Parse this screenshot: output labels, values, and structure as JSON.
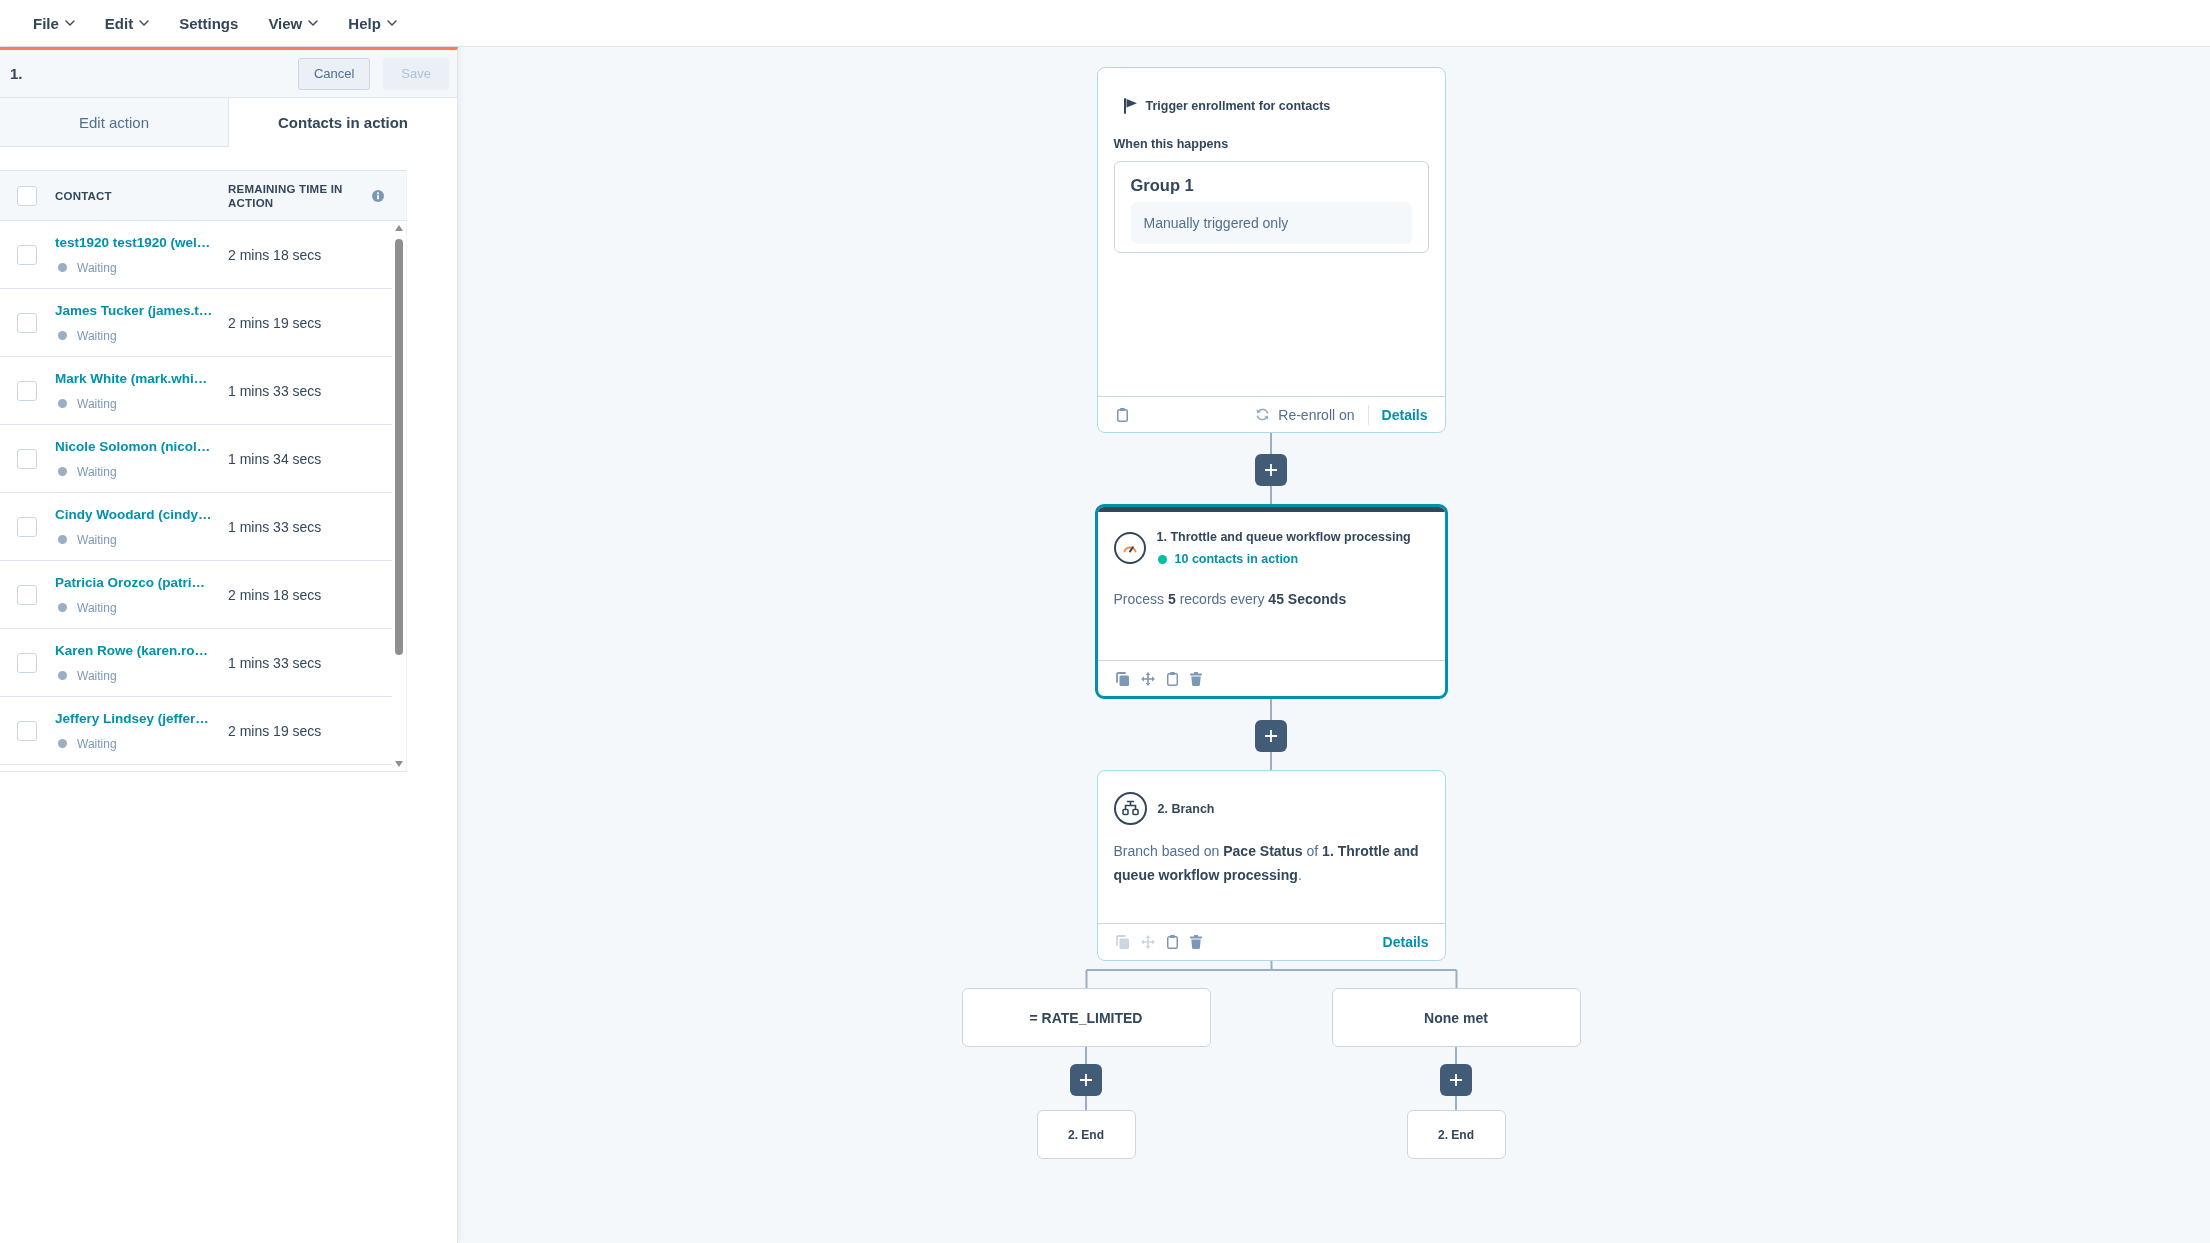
{
  "menu_bar": {
    "items": [
      {
        "label": "File",
        "dropdown": true
      },
      {
        "label": "Edit",
        "dropdown": true
      },
      {
        "label": "Settings",
        "dropdown": false
      },
      {
        "label": "View",
        "dropdown": true
      },
      {
        "label": "Help",
        "dropdown": true
      }
    ]
  },
  "panel": {
    "title": "1.",
    "buttons": [
      {
        "label": "Cancel",
        "disabled": false
      },
      {
        "label": "Save",
        "disabled": true
      }
    ],
    "tabs": [
      {
        "label": "Edit action",
        "selected": false
      },
      {
        "label": "Contacts in action",
        "selected": true
      }
    ],
    "table": {
      "select_all": {
        "checked": false
      },
      "columns": [
        "CONTACT",
        "REMAINING TIME IN ACTION"
      ],
      "rows": [
        {
          "contact": "test1920 test1920 (wel…",
          "status": "Waiting",
          "remaining": "2 mins 18 secs",
          "checked": false
        },
        {
          "contact": "James Tucker (james.t…",
          "status": "Waiting",
          "remaining": "2 mins 19 secs",
          "checked": false
        },
        {
          "contact": "Mark White (mark.whi…",
          "status": "Waiting",
          "remaining": "1 mins 33 secs",
          "checked": false
        },
        {
          "contact": "Nicole Solomon (nicol…",
          "status": "Waiting",
          "remaining": "1 mins 34 secs",
          "checked": false
        },
        {
          "contact": "Cindy Woodard (cindy…",
          "status": "Waiting",
          "remaining": "1 mins 33 secs",
          "checked": false
        },
        {
          "contact": "Patricia Orozco (patri…",
          "status": "Waiting",
          "remaining": "2 mins 18 secs",
          "checked": false
        },
        {
          "contact": "Karen Rowe (karen.ro…",
          "status": "Waiting",
          "remaining": "1 mins 33 secs",
          "checked": false
        },
        {
          "contact": "Jeffery Lindsey (jeffer…",
          "status": "Waiting",
          "remaining": "2 mins 19 secs",
          "checked": false
        }
      ]
    }
  },
  "workflow": {
    "trigger": {
      "title": "Trigger enrollment for contacts",
      "section_label": "When this happens",
      "group": {
        "title": "Group 1",
        "condition": "Manually triggered only"
      },
      "reenroll": "Re-enroll on",
      "details_link": "Details"
    },
    "actions": [
      {
        "kind": "throttle",
        "selected": true,
        "title": "1. Throttle and queue workflow processing",
        "status": "10 contacts in action",
        "description": "Process **5** records every **45 Seconds**",
        "toolbar": [
          {
            "kind": "copy",
            "disabled": false
          },
          {
            "kind": "move",
            "disabled": false
          },
          {
            "kind": "clipboard",
            "disabled": false
          },
          {
            "kind": "delete",
            "disabled": false
          }
        ]
      },
      {
        "kind": "branch",
        "selected": false,
        "title": "2. Branch",
        "description": "Branch based on **Pace Status** of **1. Throttle and queue workflow processing**.",
        "toolbar": [
          {
            "kind": "copy",
            "disabled": true
          },
          {
            "kind": "move",
            "disabled": true
          },
          {
            "kind": "clipboard",
            "disabled": false
          },
          {
            "kind": "delete",
            "disabled": false
          }
        ],
        "details_link": "Details"
      }
    ],
    "branches": [
      {
        "label": "= RATE_LIMITED",
        "end": "2. End"
      },
      {
        "label": "None met",
        "end": "2. End"
      }
    ]
  }
}
